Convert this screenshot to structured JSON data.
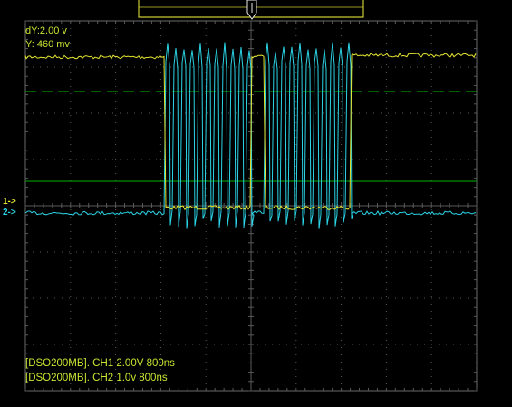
{
  "cursor_readout": {
    "dy": "dY:2.00 v",
    "y": "Y:  460 mv"
  },
  "channel_markers": {
    "ch1": "1->",
    "ch2": "2->"
  },
  "status_lines": [
    "[DSO200MB]. CH1 2.00V 800ns",
    "[DSO200MB]. CH2 1.0v 800ns"
  ],
  "colors": {
    "background": "#000000",
    "grid": "#5a5a5a",
    "ch1_trace": "#e6e632",
    "ch2_trace": "#2bd4e6",
    "cursor": "#00c000",
    "readout_text": "#c8e632",
    "trigger_bar": "#c8c832"
  },
  "icons": {
    "trigger_position": "trigger-position-marker-icon"
  }
}
